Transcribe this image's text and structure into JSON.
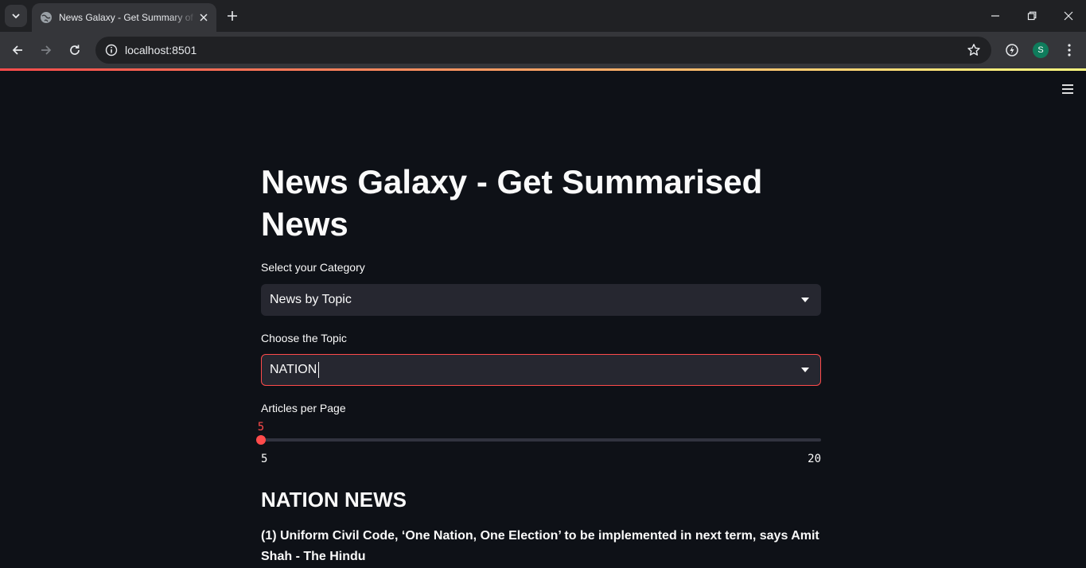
{
  "browser": {
    "tab_title": "News Galaxy - Get Summary of",
    "url": "localhost:8501",
    "profile_initial": "S"
  },
  "app": {
    "title": "News Galaxy - Get Summarised News",
    "category": {
      "label": "Select your Category",
      "value": "News by Topic"
    },
    "topic": {
      "label": "Choose the Topic",
      "value": "NATION"
    },
    "articles_slider": {
      "label": "Articles per Page",
      "value": 5,
      "min": 5,
      "max": 20
    },
    "section_heading": "NATION NEWS",
    "articles": [
      {
        "title": "(1) Uniform Civil Code, ‘One Nation, One Election’ to be implemented in next term, says Amit Shah - The Hindu"
      }
    ]
  },
  "colors": {
    "accent": "#ff4b4b",
    "background": "#0e1117",
    "widget": "#262730"
  }
}
